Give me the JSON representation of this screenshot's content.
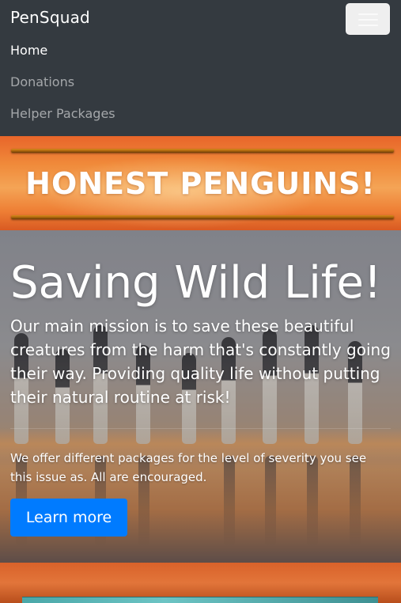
{
  "navbar": {
    "brand": "PenSquad",
    "toggler_icon": "hamburger-icon",
    "items": [
      {
        "label": "Home",
        "active": true
      },
      {
        "label": "Donations",
        "active": false
      },
      {
        "label": "Helper Packages",
        "active": false
      }
    ]
  },
  "banner": {
    "title": "HONEST PENGUINS!"
  },
  "hero": {
    "title": "Saving Wild Life!",
    "lead": "Our main mission is to save these beautiful creatures from the harm that's constantly going their way. Providing quality life without putting their natural routine at risk!",
    "text": "We offer different packages for the level of severity you see this issue as. All are encouraged.",
    "button_label": "Learn more"
  },
  "colors": {
    "navbar_bg": "#343a40",
    "primary_button": "#007bff",
    "banner_orange": "#f08a3a"
  }
}
